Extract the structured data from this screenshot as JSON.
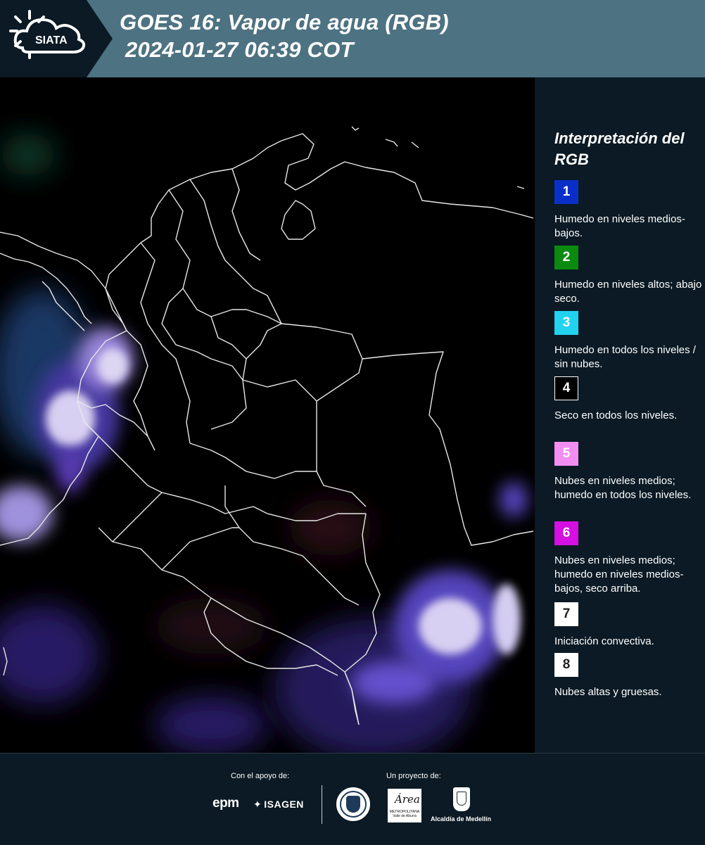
{
  "header": {
    "logo_text": "SIATA",
    "title_line1": "GOES 16: Vapor de agua (RGB)",
    "title_line2": "2024-01-27 06:39 COT"
  },
  "legend": {
    "title": "Interpretación del RGB",
    "items": [
      {
        "number": "1",
        "color": "#0a2fc8",
        "text": "Humedo en niveles medios-bajos."
      },
      {
        "number": "2",
        "color": "#0b8a10",
        "text": "Humedo en niveles altos; abajo seco."
      },
      {
        "number": "3",
        "color": "#22d3f0",
        "text": "Humedo en todos los niveles / sin nubes."
      },
      {
        "number": "4",
        "color": "#000000",
        "text": "Seco en todos los niveles."
      },
      {
        "number": "5",
        "color": "#f28ef2",
        "text": "Nubes en niveles medios; humedo en todos los niveles."
      },
      {
        "number": "6",
        "color": "#d60fe3",
        "text": "Nubes en niveles medios; humedo en niveles medios-bajos, seco arriba."
      },
      {
        "number": "7",
        "color": "#ffffff",
        "text": "Iniciación convectiva."
      },
      {
        "number": "8",
        "color": "#ffffff",
        "text": "Nubes altas y gruesas."
      }
    ]
  },
  "footer": {
    "support_label": "Con el apoyo de:",
    "project_label": "Un proyecto de:",
    "epm": "epm",
    "isagen": "ISAGEN",
    "area_word": "Área",
    "area_sub": "METROPOLITANA Valle de Aburrá",
    "alcaldia": "Alcaldía de Medellín"
  }
}
